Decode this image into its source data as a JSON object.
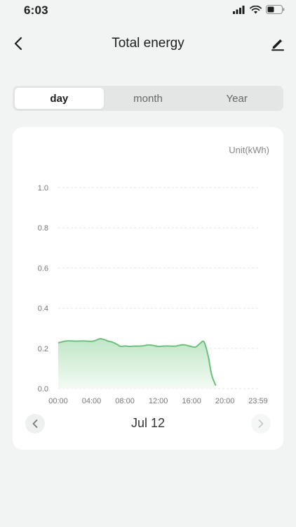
{
  "status_bar": {
    "time": "6:03"
  },
  "header": {
    "title": "Total energy"
  },
  "tabs": [
    {
      "label": "day",
      "active": true
    },
    {
      "label": "month",
      "active": false
    },
    {
      "label": "Year",
      "active": false
    }
  ],
  "chart_card": {
    "unit_label": "Unit(kWh)",
    "date_label": "Jul 12"
  },
  "colors": {
    "accent": "#6dc07d",
    "fill_top": "#bfe6c6",
    "fill_bottom": "#f3fbf4"
  },
  "chart_data": {
    "type": "area",
    "x_tick_labels": [
      "00:00",
      "04:00",
      "08:00",
      "12:00",
      "16:00",
      "20:00",
      "23:59"
    ],
    "x_tick_hours": [
      0,
      4,
      8,
      12,
      16,
      20,
      23.983
    ],
    "y_tick_labels": [
      "0.0",
      "0.2",
      "0.4",
      "0.6",
      "0.8",
      "1.0"
    ],
    "y_ticks": [
      0,
      0.2,
      0.4,
      0.6,
      0.8,
      1.0
    ],
    "ylim": [
      0,
      1.0
    ],
    "xlim": [
      0,
      23.983
    ],
    "ylabel": "Unit(kWh)",
    "grid": true,
    "series": [
      {
        "x": [
          0,
          1,
          2,
          3,
          4,
          4.5,
          5,
          5.5,
          6,
          6.5,
          7,
          7.5,
          8,
          8.5,
          9,
          10,
          11,
          12,
          12.5,
          13,
          14,
          15,
          16,
          16.5,
          17,
          17.5,
          18,
          18.4,
          18.9
        ],
        "y": [
          0.228,
          0.237,
          0.236,
          0.237,
          0.235,
          0.24,
          0.248,
          0.244,
          0.236,
          0.231,
          0.221,
          0.21,
          0.212,
          0.21,
          0.211,
          0.212,
          0.217,
          0.21,
          0.211,
          0.212,
          0.211,
          0.218,
          0.209,
          0.207,
          0.224,
          0.232,
          0.16,
          0.07,
          0.015
        ]
      }
    ]
  }
}
